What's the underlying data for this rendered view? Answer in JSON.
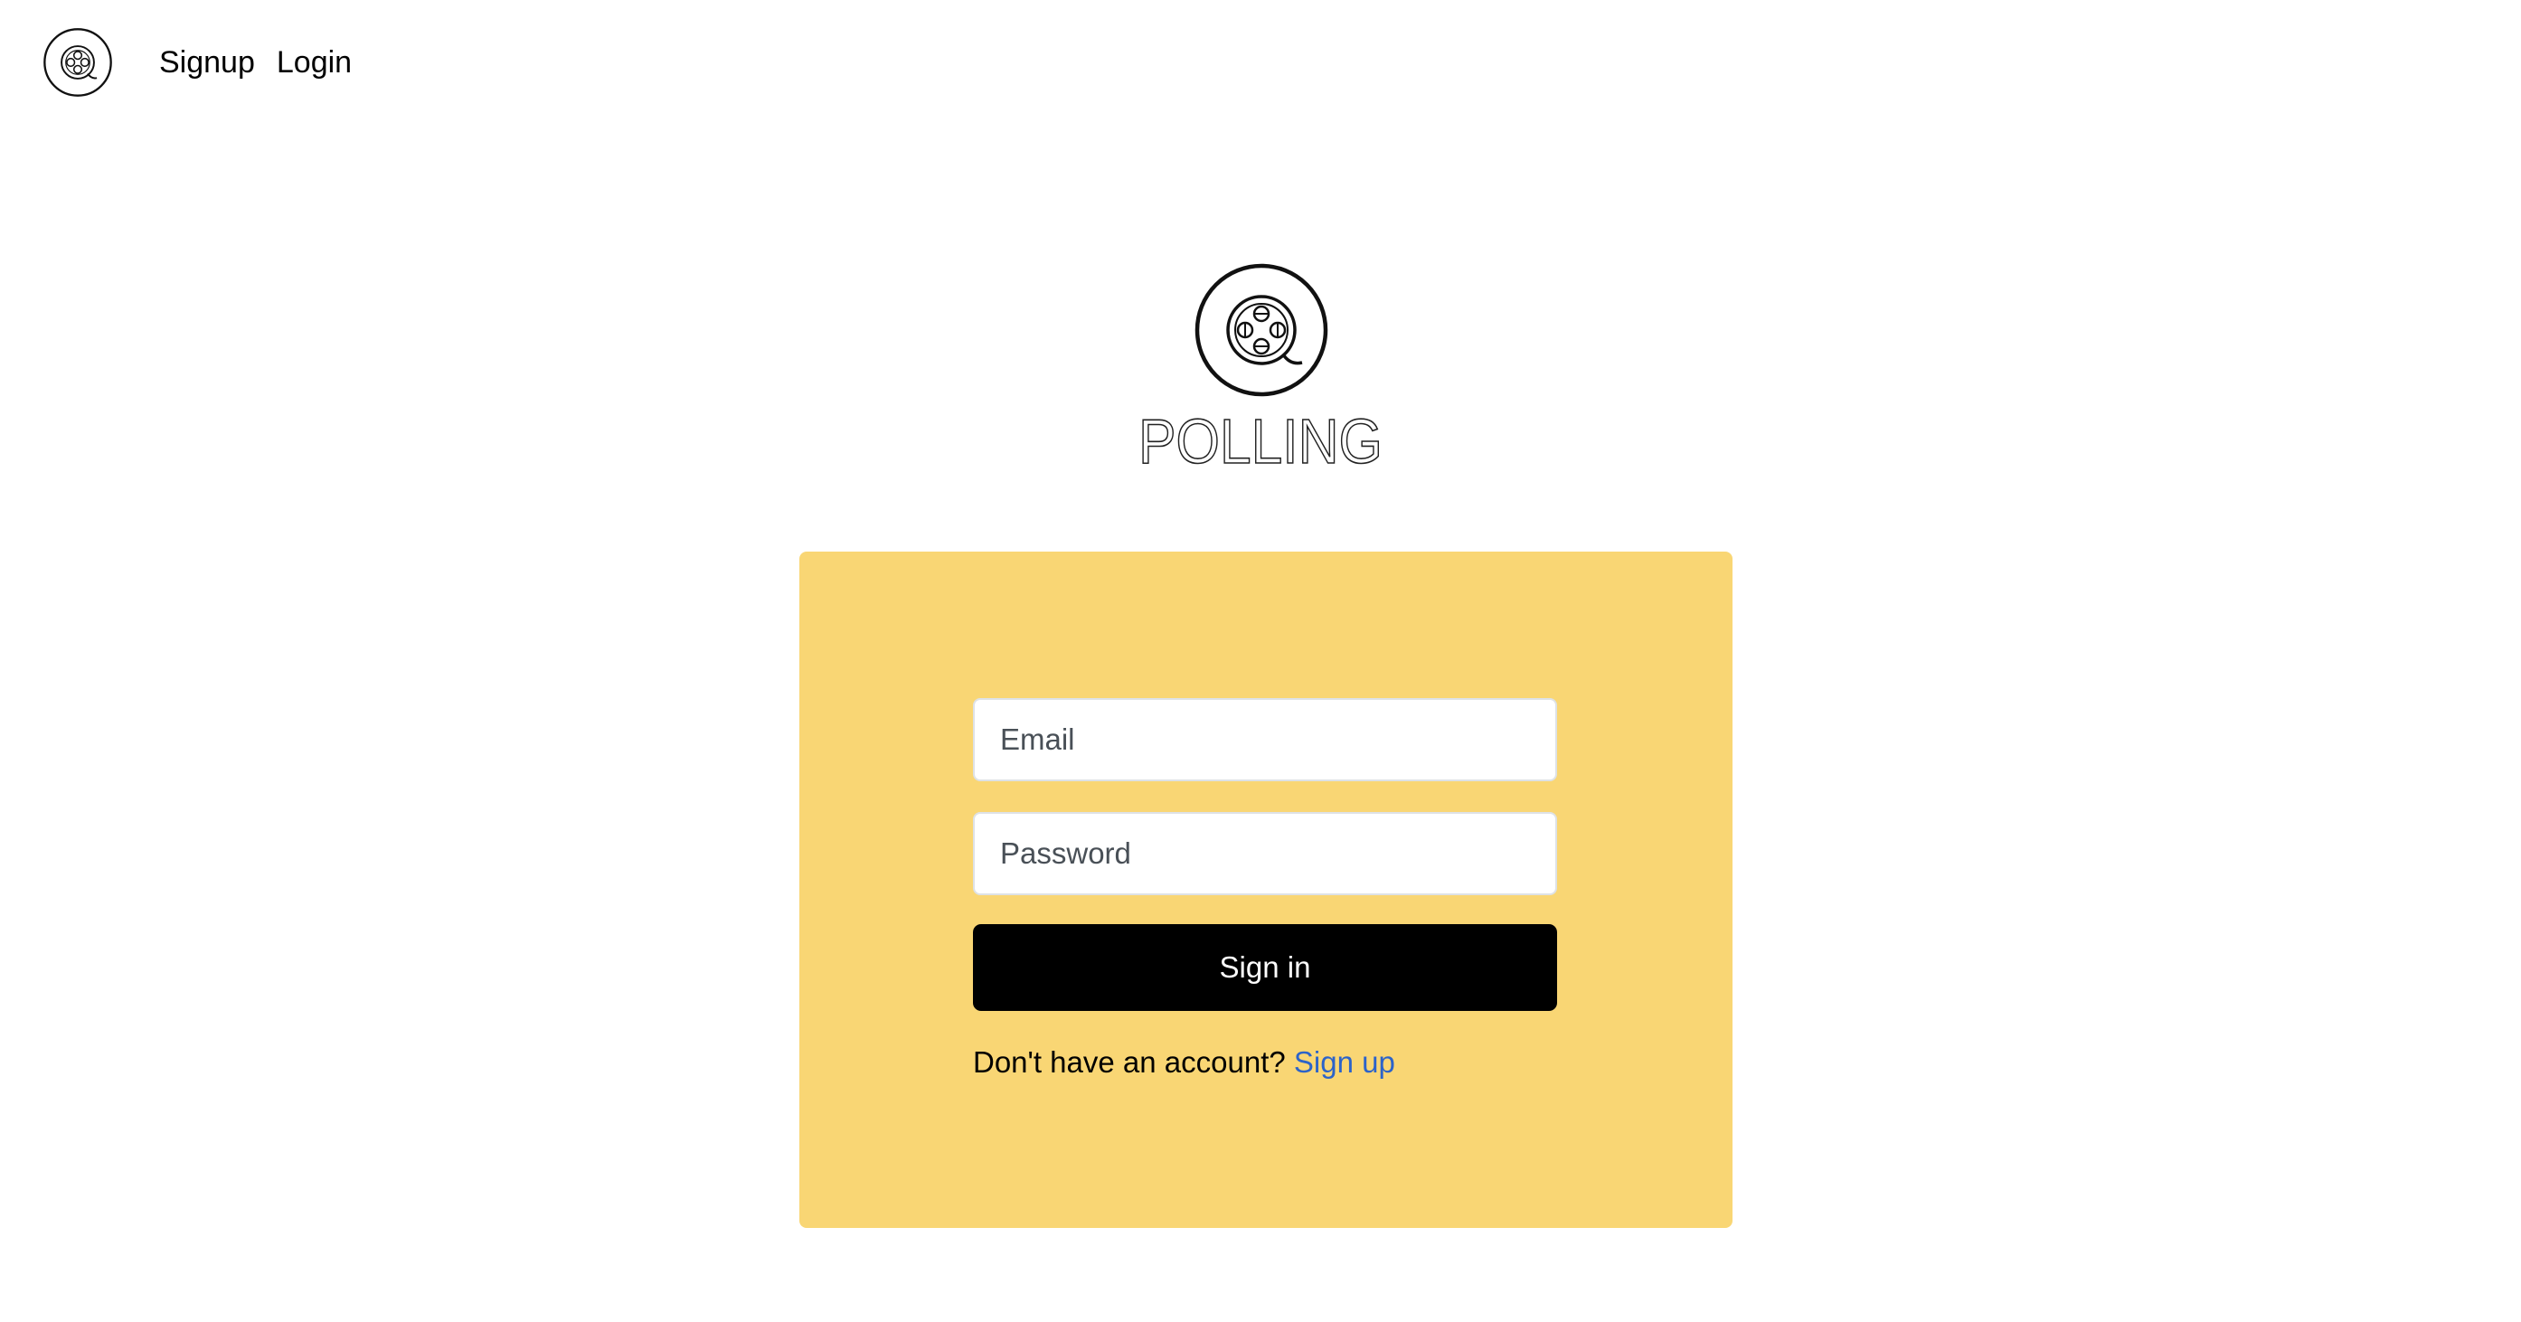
{
  "nav": {
    "logo_icon": "film-reel-icon",
    "links": [
      {
        "label": "Signup"
      },
      {
        "label": "Login"
      }
    ]
  },
  "brand": {
    "logo_icon": "film-reel-icon",
    "wordmark": "POLLING"
  },
  "login_form": {
    "email_placeholder": "Email",
    "password_placeholder": "Password",
    "submit_label": "Sign in",
    "signup_prompt": "Don't have an account?",
    "signup_link_label": "Sign up"
  },
  "colors": {
    "card_background": "#f9d674",
    "button_background": "#000000",
    "link": "#2c63c9"
  }
}
